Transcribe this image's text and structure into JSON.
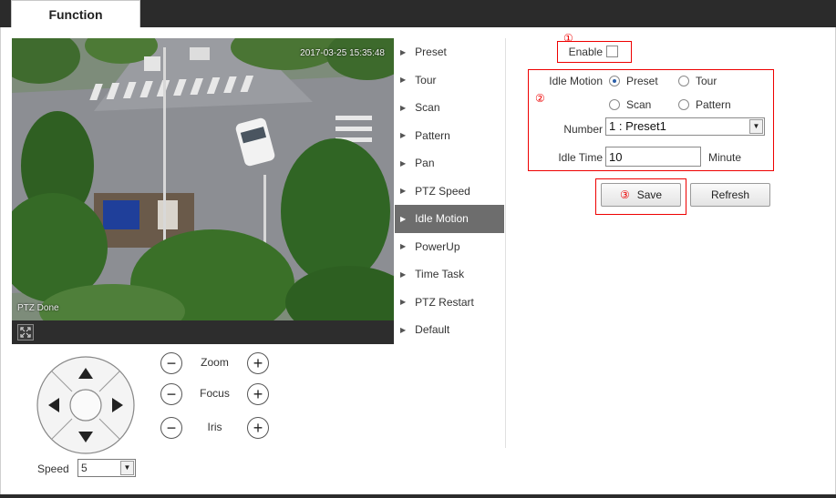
{
  "tab": {
    "label": "Function"
  },
  "video": {
    "timestamp": "2017-03-25 15:35:48",
    "overlay_text": "PTZ Done",
    "fullscreen_icon": "fullscreen-icon"
  },
  "ptz": {
    "zoom_label": "Zoom",
    "focus_label": "Focus",
    "iris_label": "Iris",
    "minus_symbol": "−",
    "plus_symbol": "+",
    "speed_label": "Speed",
    "speed_value": "5",
    "dpad_icons": [
      "arrow-up-icon",
      "arrow-down-icon",
      "arrow-left-icon",
      "arrow-right-icon"
    ]
  },
  "menu": {
    "items": [
      {
        "label": "Preset"
      },
      {
        "label": "Tour"
      },
      {
        "label": "Scan"
      },
      {
        "label": "Pattern"
      },
      {
        "label": "Pan"
      },
      {
        "label": "PTZ Speed"
      },
      {
        "label": "Idle Motion"
      },
      {
        "label": "PowerUp"
      },
      {
        "label": "Time Task"
      },
      {
        "label": "PTZ Restart"
      },
      {
        "label": "Default"
      }
    ],
    "active": "Idle Motion",
    "arrow_glyph": "▶"
  },
  "form": {
    "marker1": "①",
    "marker2": "②",
    "marker3": "③",
    "enable_label": "Enable",
    "enable_checked": false,
    "idle_motion_label": "Idle Motion",
    "options": [
      "Preset",
      "Tour",
      "Scan",
      "Pattern"
    ],
    "selected_option": "Preset",
    "number_label": "Number",
    "number_value": "1 : Preset1",
    "idle_time_label": "Idle Time",
    "idle_time_value": "10",
    "idle_time_unit": "Minute",
    "save_label": "Save",
    "refresh_label": "Refresh"
  },
  "colors": {
    "topbar": "#2b2b2b",
    "active_menu": "#6d6d6d",
    "annotation": "#e00000"
  }
}
